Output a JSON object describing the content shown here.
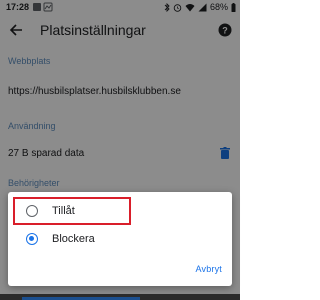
{
  "status_bar": {
    "time": "17:28",
    "battery": "68%",
    "icons": [
      "notification-icon",
      "image-icon",
      "bluetooth-icon",
      "alarm-icon",
      "wifi-icon",
      "signal-icon",
      "battery-icon"
    ]
  },
  "app_bar": {
    "title": "Platsinställningar",
    "back_icon": "arrow-left-icon",
    "help_icon": "help-icon"
  },
  "sections": {
    "webbplats_header": "Webbplats",
    "webbplats_value": "https://husbilsplatser.husbilsklubben.se",
    "anvandning_header": "Användning",
    "anvandning_value": "27 B sparad data",
    "behorigheter_header": "Behörigheter"
  },
  "dialog": {
    "options": [
      {
        "label": "Tillåt",
        "selected": false
      },
      {
        "label": "Blockera",
        "selected": true
      }
    ],
    "cancel_label": "Avbryt",
    "highlight_color": "#d91e2a",
    "accent_color": "#1a73e8"
  }
}
